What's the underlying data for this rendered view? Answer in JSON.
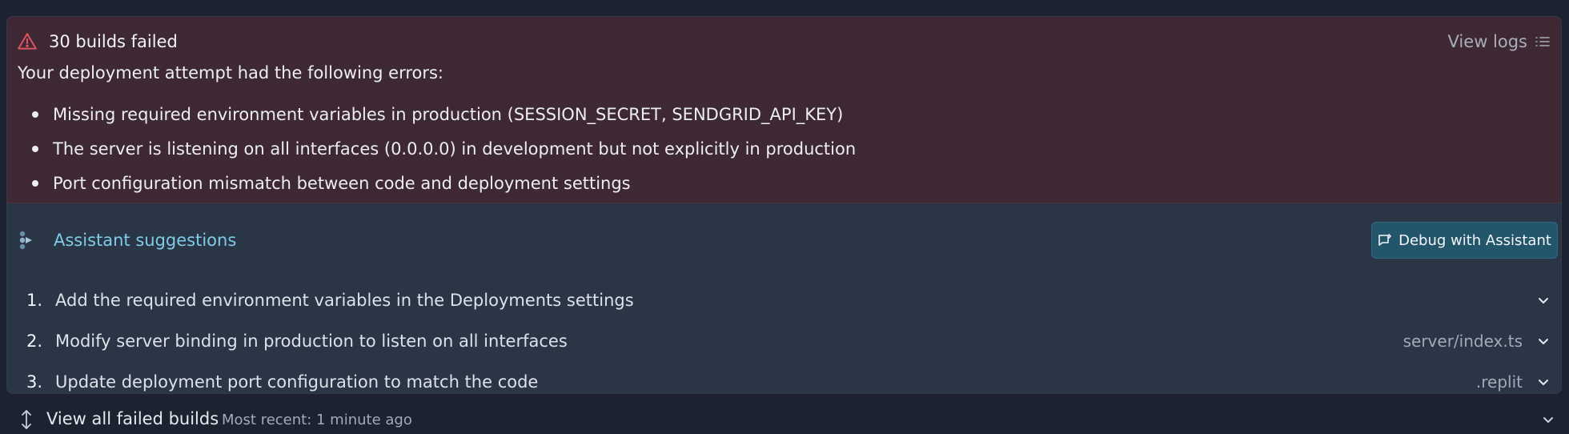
{
  "error": {
    "title": "30 builds failed",
    "view_logs_label": "View logs",
    "intro": "Your deployment attempt had the following errors:",
    "items": [
      "Missing required environment variables in production (SESSION_SECRET, SENDGRID_API_KEY)",
      "The server is listening on all interfaces (0.0.0.0) in development but not explicitly in production",
      "Port configuration mismatch between code and deployment settings"
    ]
  },
  "assistant": {
    "title": "Assistant suggestions",
    "debug_button_label": "Debug with Assistant",
    "suggestions": [
      {
        "number": "1.",
        "text": "Add the required environment variables in the Deployments settings",
        "file": ""
      },
      {
        "number": "2.",
        "text": "Modify server binding in production to listen on all interfaces",
        "file": "server/index.ts"
      },
      {
        "number": "3.",
        "text": "Update deployment port configuration to match the code",
        "file": ".replit"
      }
    ]
  },
  "footer": {
    "title": "View all failed builds",
    "meta": "Most recent: 1 minute ago"
  },
  "icons": {
    "warning": "warning-triangle-icon",
    "logs": "list-icon",
    "assistant": "assistant-icon",
    "chat": "chat-icon",
    "chevron": "chevron-down-icon",
    "expand": "expand-vertical-icon"
  },
  "colors": {
    "error_bg": "#3e2833",
    "assistant_bg": "#2a3546",
    "accent": "#7fcbe8",
    "button_bg": "#23566b",
    "warning": "#e0555f"
  }
}
